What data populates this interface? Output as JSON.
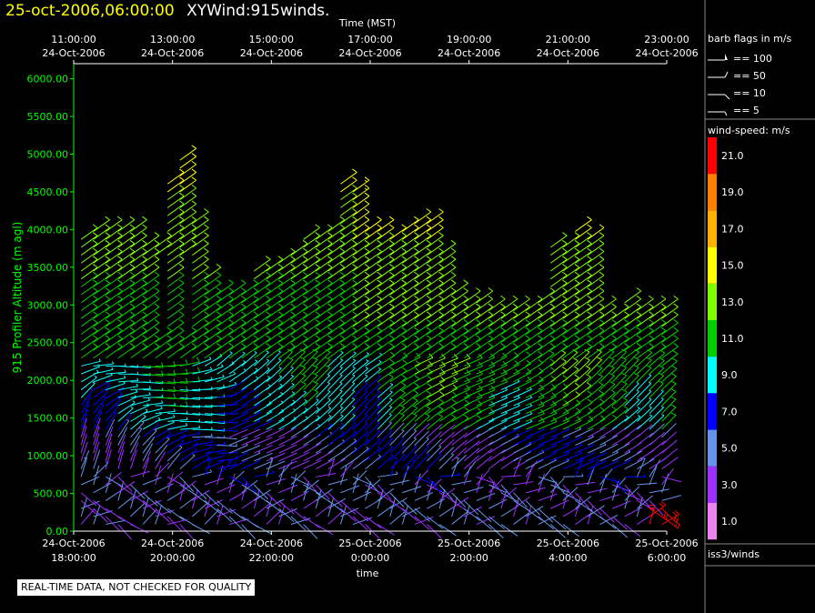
{
  "header": {
    "date": "25-oct-2006,06:00:00",
    "title": "XYWind:915winds."
  },
  "notice": "REAL-TIME DATA, NOT CHECKED FOR QUALITY",
  "chart_data": {
    "type": "wind-barb time-height",
    "ylabel": "915 Profiler Altitude (m agl)",
    "xlabel": "time",
    "top_axis_title": "Time (MST)",
    "yticks": [
      "0.00",
      "500.00",
      "1000.00",
      "1500.00",
      "2000.00",
      "2500.00",
      "3000.00",
      "3500.00",
      "4000.00",
      "4500.00",
      "5000.00",
      "5500.00",
      "6000.00"
    ],
    "ylim": [
      0,
      6200
    ],
    "xlim_hours_utc": [
      18,
      30
    ],
    "top_ticks": [
      {
        "h": 18,
        "time": "11:00:00",
        "date": "24-Oct-2006"
      },
      {
        "h": 20,
        "time": "13:00:00",
        "date": "24-Oct-2006"
      },
      {
        "h": 22,
        "time": "15:00:00",
        "date": "24-Oct-2006"
      },
      {
        "h": 24,
        "time": "17:00:00",
        "date": "24-Oct-2006"
      },
      {
        "h": 26,
        "time": "19:00:00",
        "date": "24-Oct-2006"
      },
      {
        "h": 28,
        "time": "21:00:00",
        "date": "24-Oct-2006"
      },
      {
        "h": 30,
        "time": "23:00:00",
        "date": "24-Oct-2006"
      }
    ],
    "bottom_ticks": [
      {
        "h": 18,
        "date": "24-Oct-2006",
        "time": "18:00:00"
      },
      {
        "h": 20,
        "date": "24-Oct-2006",
        "time": "20:00:00"
      },
      {
        "h": 22,
        "date": "24-Oct-2006",
        "time": "22:00:00"
      },
      {
        "h": 24,
        "date": "25-Oct-2006",
        "time": "0:00:00"
      },
      {
        "h": 26,
        "date": "25-Oct-2006",
        "time": "2:00:00"
      },
      {
        "h": 28,
        "date": "25-Oct-2006",
        "time": "4:00:00"
      },
      {
        "h": 30,
        "date": "25-Oct-2006",
        "time": "6:00:00"
      }
    ],
    "profile_hours": [
      18.15,
      18.4,
      18.65,
      18.9,
      19.15,
      19.4,
      19.65,
      19.9,
      20.15,
      20.4,
      20.65,
      20.9,
      21.15,
      21.4,
      21.65,
      21.9,
      22.15,
      22.4,
      22.65,
      22.9,
      23.15,
      23.4,
      23.65,
      23.9,
      24.15,
      24.4,
      24.65,
      24.9,
      25.15,
      25.4,
      25.65,
      25.9,
      26.15,
      26.4,
      26.65,
      26.9,
      27.15,
      27.4,
      27.65,
      27.9,
      28.15,
      28.4,
      28.65,
      28.9,
      29.15,
      29.4,
      29.65,
      29.9
    ],
    "profile_tops_m": [
      3950,
      4050,
      4050,
      4050,
      4050,
      3800,
      3800,
      4700,
      4950,
      4150,
      3400,
      3200,
      3150,
      3200,
      3500,
      3550,
      3650,
      3750,
      3900,
      3950,
      4000,
      4650,
      4550,
      4000,
      4050,
      3950,
      4050,
      4100,
      4150,
      3700,
      3200,
      3100,
      3050,
      3000,
      3000,
      2950,
      3000,
      3050,
      3800,
      3850,
      4000,
      3950,
      2950,
      2850,
      3100,
      3000,
      2950,
      2950
    ],
    "barb_spacing_m": 105,
    "barb_legend": {
      "title": "barb flags in m/s",
      "items": [
        {
          "label": "== 100",
          "type": "pennant"
        },
        {
          "label": "== 50",
          "type": "flag"
        },
        {
          "label": "== 10",
          "type": "full"
        },
        {
          "label": "== 5",
          "type": "half"
        }
      ]
    },
    "color_scale": {
      "title": "wind-speed: m/s",
      "bins": [
        {
          "label": "21.0",
          "color": "#ff0000"
        },
        {
          "label": "19.0",
          "color": "#ff7f00"
        },
        {
          "label": "17.0",
          "color": "#ffb000"
        },
        {
          "label": "15.0",
          "color": "#ffff00"
        },
        {
          "label": "13.0",
          "color": "#7fff00"
        },
        {
          "label": "11.0",
          "color": "#00d000"
        },
        {
          "label": "9.0",
          "color": "#00ffff"
        },
        {
          "label": "7.0",
          "color": "#0000ff"
        },
        {
          "label": "5.0",
          "color": "#6495ed"
        },
        {
          "label": "3.0",
          "color": "#9b30ff"
        },
        {
          "label": "1.0",
          "color": "#ee82ee"
        }
      ]
    },
    "source_label": "iss3/winds",
    "axis_color": "#00ff00"
  }
}
